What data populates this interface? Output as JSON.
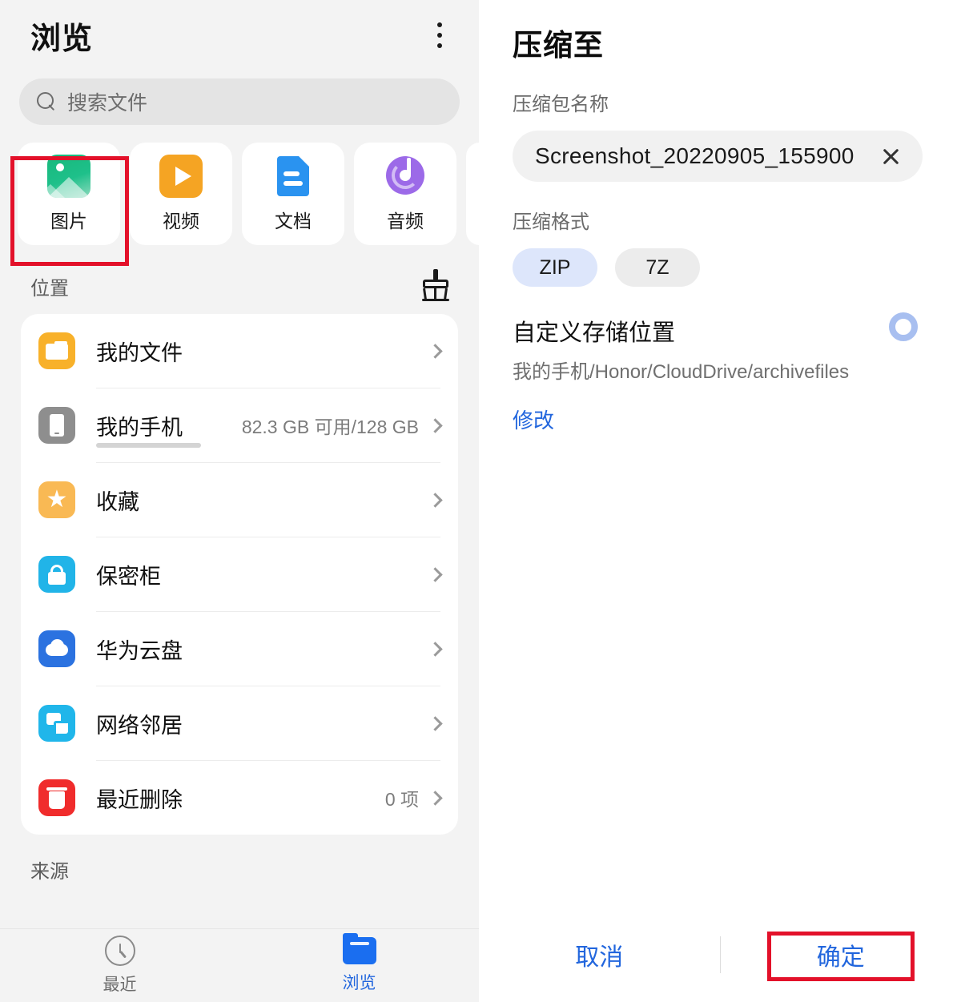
{
  "left": {
    "header": {
      "title": "浏览",
      "menu_icon": "kebab-menu-icon"
    },
    "search": {
      "placeholder": "搜索文件",
      "icon": "search-icon"
    },
    "categories": [
      {
        "label": "图片",
        "icon": "image-icon"
      },
      {
        "label": "视频",
        "icon": "video-icon"
      },
      {
        "label": "文档",
        "icon": "document-icon"
      },
      {
        "label": "音频",
        "icon": "audio-icon"
      }
    ],
    "location_section": {
      "label": "位置",
      "clean_icon": "broom-icon",
      "rows": [
        {
          "name": "我的文件",
          "meta": "",
          "icon": "folder-icon"
        },
        {
          "name": "我的手机",
          "meta": "82.3 GB 可用/128 GB",
          "icon": "phone-icon",
          "usage_percent": 36
        },
        {
          "name": "收藏",
          "meta": "",
          "icon": "star-icon"
        },
        {
          "name": "保密柜",
          "meta": "",
          "icon": "lock-icon"
        },
        {
          "name": "华为云盘",
          "meta": "",
          "icon": "cloud-icon"
        },
        {
          "name": "网络邻居",
          "meta": "",
          "icon": "network-icon"
        },
        {
          "name": "最近删除",
          "meta": "0 项",
          "icon": "trash-icon"
        }
      ]
    },
    "source_section": {
      "label": "来源"
    },
    "tabbar": [
      {
        "label": "最近",
        "icon": "clock-icon",
        "active": false
      },
      {
        "label": "浏览",
        "icon": "folder-icon",
        "active": true
      }
    ]
  },
  "right": {
    "title": "压缩至",
    "name_label": "压缩包名称",
    "name_value": "Screenshot_20220905_155900",
    "clear_icon": "close-icon",
    "format_label": "压缩格式",
    "formats": [
      {
        "label": "ZIP",
        "selected": true
      },
      {
        "label": "7Z",
        "selected": false
      }
    ],
    "storage": {
      "title": "自定义存储位置",
      "path": "我的手机/Honor/CloudDrive/archivefiles",
      "modify_label": "修改",
      "indicator_icon": "radio-circle-icon"
    },
    "actions": {
      "cancel": "取消",
      "confirm": "确定"
    }
  },
  "colors": {
    "accent_blue": "#2266dd",
    "annotation_red": "#e3112a",
    "chip_selected": "#dde6fb",
    "panel_bg": "#f3f3f3"
  }
}
